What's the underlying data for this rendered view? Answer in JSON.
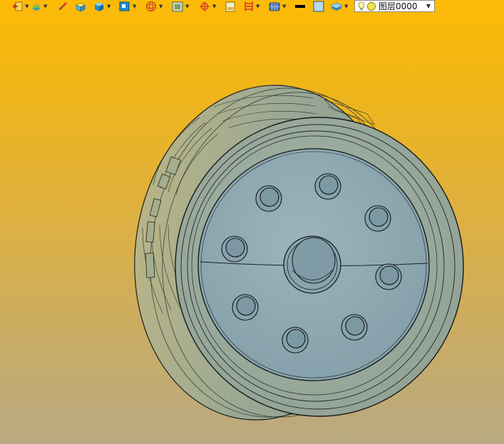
{
  "toolbar": {
    "icons": [
      {
        "name": "exit-icon",
        "dropdown": true
      },
      {
        "name": "layer-stack-icon",
        "dropdown": true
      },
      {
        "name": "brush-icon",
        "dropdown": false
      },
      {
        "name": "paint-bucket-icon",
        "dropdown": false
      },
      {
        "name": "solid-cube-icon",
        "dropdown": true
      },
      {
        "name": "view-cube-icon",
        "dropdown": true
      },
      {
        "name": "wireframe-sphere-icon",
        "dropdown": true
      },
      {
        "name": "shading-square-icon",
        "dropdown": true
      },
      {
        "name": "crosshair-icon",
        "dropdown": true
      },
      {
        "name": "note-icon",
        "dropdown": false
      },
      {
        "name": "ladder-icon",
        "dropdown": true
      },
      {
        "name": "globe-grid-icon",
        "dropdown": true
      },
      {
        "name": "line-color-icon",
        "dropdown": false
      },
      {
        "name": "fill-color-icon",
        "dropdown": false
      },
      {
        "name": "plane-stack-icon",
        "dropdown": true
      }
    ],
    "layer": {
      "value": "图层0000",
      "options_visible": [
        "图层0000"
      ]
    }
  },
  "colors": {
    "background_top": "#fdbb06",
    "background_bottom": "#b9a982",
    "part_face": "#8aa7b0",
    "part_rim": "#9ab0a8",
    "outline": "#1a1f22"
  }
}
